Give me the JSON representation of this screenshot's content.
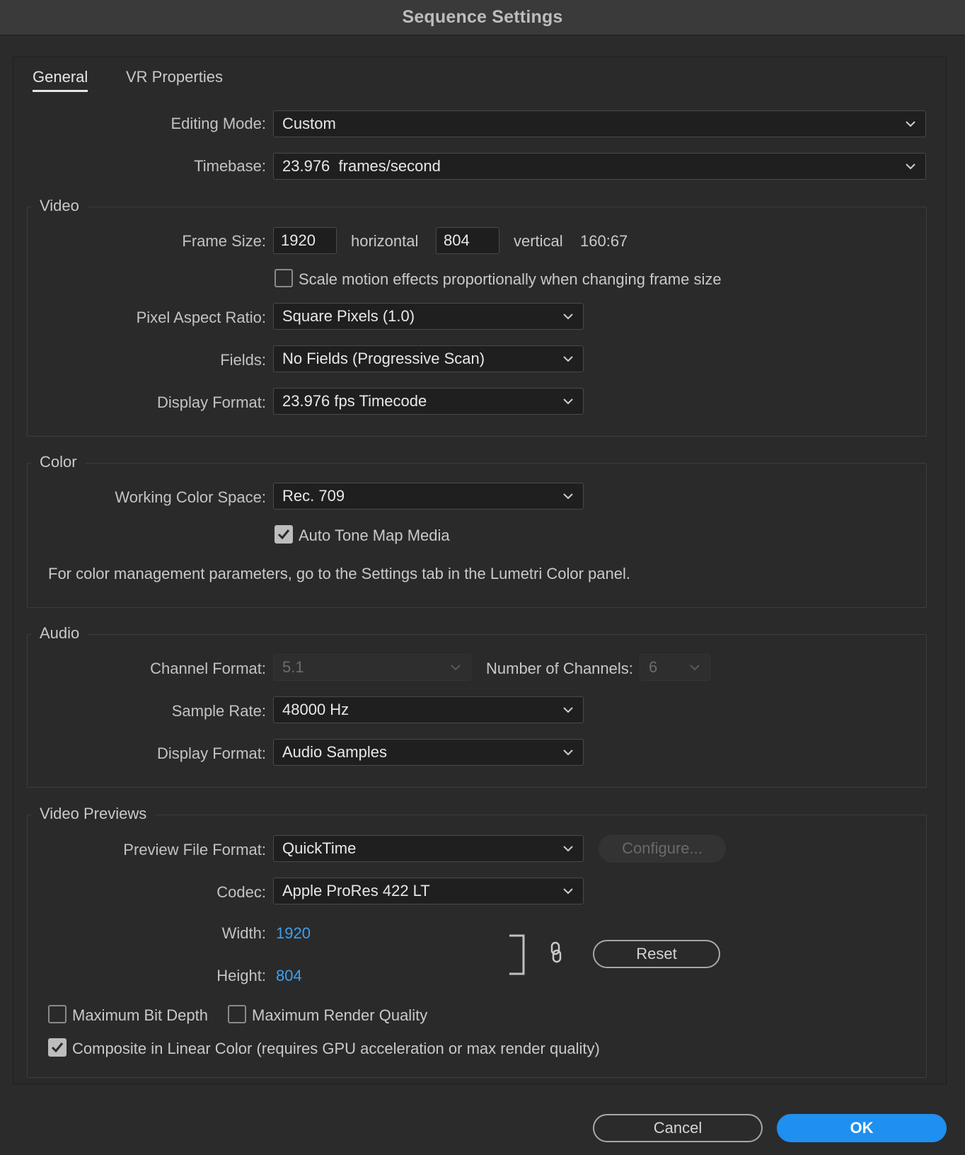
{
  "window": {
    "title": "Sequence Settings"
  },
  "tabs": [
    {
      "label": "General",
      "active": true
    },
    {
      "label": "VR Properties",
      "active": false
    }
  ],
  "general": {
    "editing_mode_label": "Editing Mode:",
    "editing_mode_value": "Custom",
    "timebase_label": "Timebase:",
    "timebase_value": "23.976  frames/second"
  },
  "video": {
    "group_title": "Video",
    "frame_size_label": "Frame Size:",
    "frame_width": "1920",
    "horizontal_label": "horizontal",
    "frame_height": "804",
    "vertical_label": "vertical",
    "aspect_ratio_text": "160:67",
    "scale_motion_label": "Scale motion effects proportionally when changing frame size",
    "scale_motion_checked": false,
    "pixel_aspect_label": "Pixel Aspect Ratio:",
    "pixel_aspect_value": "Square Pixels (1.0)",
    "fields_label": "Fields:",
    "fields_value": "No Fields (Progressive Scan)",
    "display_format_label": "Display Format:",
    "display_format_value": "23.976 fps Timecode"
  },
  "color": {
    "group_title": "Color",
    "working_space_label": "Working Color Space:",
    "working_space_value": "Rec. 709",
    "auto_tone_map_label": "Auto Tone Map Media",
    "auto_tone_map_checked": true,
    "info_text": "For color management parameters, go to the Settings tab in the Lumetri Color panel."
  },
  "audio": {
    "group_title": "Audio",
    "channel_format_label": "Channel Format:",
    "channel_format_value": "5.1",
    "num_channels_label": "Number of Channels:",
    "num_channels_value": "6",
    "sample_rate_label": "Sample Rate:",
    "sample_rate_value": "48000 Hz",
    "display_format_label": "Display Format:",
    "display_format_value": "Audio Samples"
  },
  "previews": {
    "group_title": "Video Previews",
    "file_format_label": "Preview File Format:",
    "file_format_value": "QuickTime",
    "configure_label": "Configure...",
    "codec_label": "Codec:",
    "codec_value": "Apple ProRes 422 LT",
    "width_label": "Width:",
    "width_value": "1920",
    "height_label": "Height:",
    "height_value": "804",
    "reset_label": "Reset",
    "max_bit_depth_label": "Maximum Bit Depth",
    "max_bit_depth_checked": false,
    "max_render_quality_label": "Maximum Render Quality",
    "max_render_quality_checked": false,
    "composite_linear_label": "Composite in Linear Color (requires GPU acceleration or max render quality)",
    "composite_linear_checked": true
  },
  "footer": {
    "cancel_label": "Cancel",
    "ok_label": "OK"
  },
  "colors": {
    "accent": "#1f8ff0",
    "link": "#3ea0f0",
    "background": "#2b2b2b"
  }
}
